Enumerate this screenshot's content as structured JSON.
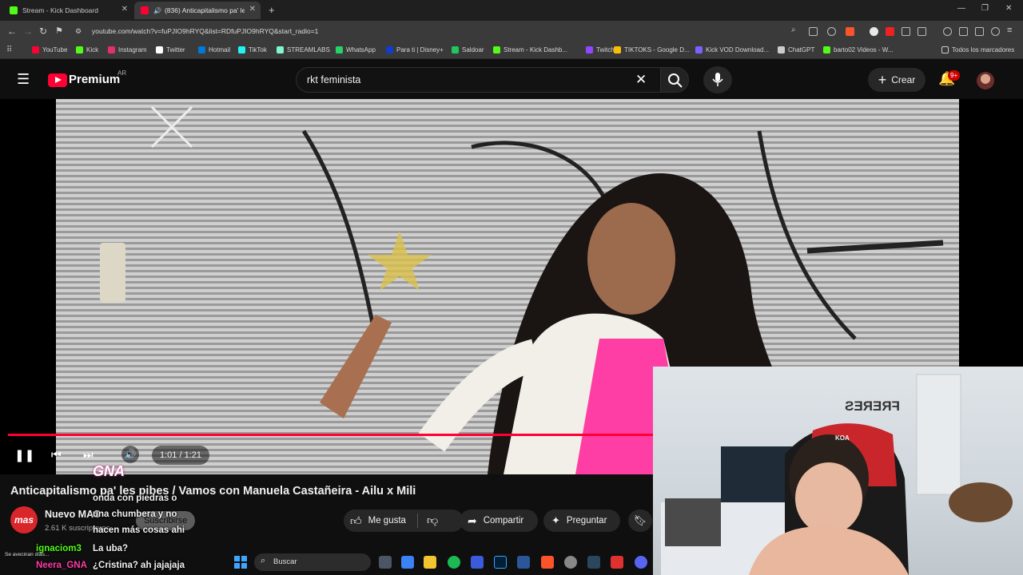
{
  "browser": {
    "tabs": [
      {
        "title": "Stream - Kick Dashboard",
        "active": false,
        "icon_color": "#53fc18"
      },
      {
        "title": "(836) Anticapitalismo pa' les pibes",
        "active": true,
        "icon_color": "#ff0033"
      }
    ],
    "new_tab": "+",
    "window_controls": [
      "—",
      "❐",
      "✕"
    ],
    "url": "youtube.com/watch?v=fuPJIO9hRYQ&list=RDfuPJIO9hRYQ&start_radio=1",
    "bookmarks": [
      {
        "label": "YouTube",
        "color": "#ff0033"
      },
      {
        "label": "Kick",
        "color": "#53fc18"
      },
      {
        "label": "Instagram",
        "color": "#e1306c"
      },
      {
        "label": "Twitter",
        "color": "#ffffff"
      },
      {
        "label": "Hotmail",
        "color": "#0078d4"
      },
      {
        "label": "TikTok",
        "color": "#25f4ee"
      },
      {
        "label": "STREAMLABS",
        "color": "#80f5d2"
      },
      {
        "label": "WhatsApp",
        "color": "#25d366"
      },
      {
        "label": "Para ti | Disney+",
        "color": "#113ccf"
      },
      {
        "label": "Saldoar",
        "color": "#22c55e"
      },
      {
        "label": "Stream - Kick Dashb...",
        "color": "#53fc18"
      },
      {
        "label": "Twitch",
        "color": "#9146ff"
      },
      {
        "label": "TIKTOKS - Google D...",
        "color": "#fbbc04"
      },
      {
        "label": "Kick VOD Download...",
        "color": "#7b61ff"
      },
      {
        "label": "ChatGPT",
        "color": "#cccccc"
      },
      {
        "label": "barto02 Videos - W...",
        "color": "#53fc18"
      }
    ],
    "bookmarks_folder": "Todos los marcadores"
  },
  "youtube": {
    "logo_text": "Premium",
    "region": "AR",
    "search_value": "rkt feminista",
    "create_label": "Crear",
    "notifications_badge": "9+",
    "accent_color": "#ff0033"
  },
  "player": {
    "time": "1:01 / 1:21",
    "progress_fraction": 0.7531,
    "title": "Anticapitalismo pa' les pibes / Vamos con Manuela Castañeira - Ailu x Mili",
    "watermark": "GNA"
  },
  "channel": {
    "name": "Nuevo MAS",
    "subscribers": "2.61 K suscriptores",
    "subscribe_label": "Suscribirse",
    "avatar_text": "mas"
  },
  "actions": {
    "like": "Me gusta",
    "share": "Compartir",
    "ask": "Preguntar"
  },
  "chat": [
    {
      "user": "",
      "text": "onda con piedras o",
      "user_color": "#ffffff"
    },
    {
      "user": "",
      "text": "una chumbera y no",
      "user_color": "#ffffff"
    },
    {
      "user": "",
      "text": "hacen más cosas ahi",
      "user_color": "#ffffff"
    },
    {
      "user": "ignaciom3",
      "text": "La uba?",
      "user_color": "#53fc18"
    },
    {
      "user": "Neera_GNA",
      "text": "¿Cristina? ah jajajaja",
      "user_color": "#ff3da8"
    }
  ],
  "taskbar": {
    "search_label": "Buscar",
    "weather_text": "Se avecinan días..."
  },
  "webcam": {
    "wall_text": "FRERES",
    "chair_text": "KOA"
  }
}
